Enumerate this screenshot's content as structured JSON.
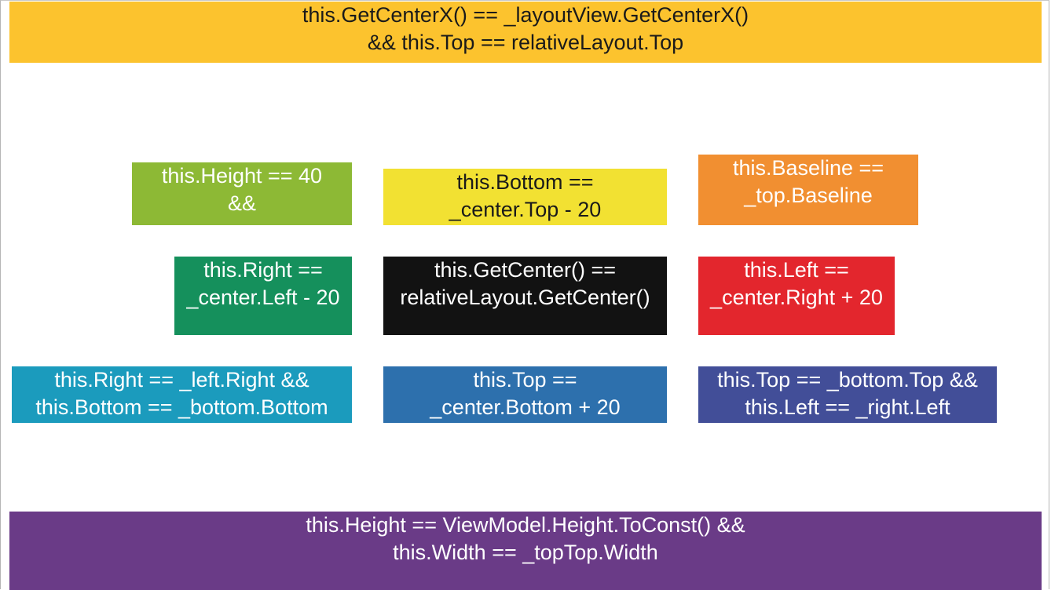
{
  "views": {
    "top": {
      "line1": "this.GetCenterX() == _layoutView.GetCenterX()",
      "line2": "&& this.Top == relativeLayout.Top",
      "color": "#fcc32e"
    },
    "top_left": {
      "line1": "this.Height == 40",
      "line2": "&&",
      "color": "#8db935"
    },
    "top_center": {
      "line1": "this.Bottom ==",
      "line2": "_center.Top - 20",
      "color": "#f2e132"
    },
    "top_right": {
      "line1": "this.Baseline ==",
      "line2": "_top.Baseline",
      "color": "#f18f31"
    },
    "mid_left": {
      "line1": "this.Right ==",
      "line2": "_center.Left - 20",
      "color": "#15905c"
    },
    "center": {
      "line1": "this.GetCenter() ==",
      "line2": "relativeLayout.GetCenter()",
      "color": "#121212"
    },
    "mid_right": {
      "line1": "this.Left ==",
      "line2": "_center.Right + 20",
      "color": "#e3262d"
    },
    "bottom_left": {
      "line1": "this.Right == _left.Right &&",
      "line2": "this.Bottom == _bottom.Bottom",
      "color": "#1b9bbd"
    },
    "bottom_center": {
      "line1": "this.Top ==",
      "line2": "_center.Bottom + 20",
      "color": "#2d70ad"
    },
    "bottom_right": {
      "line1": "this.Top == _bottom.Top &&",
      "line2": "this.Left == _right.Left",
      "color": "#424e98"
    },
    "bottom": {
      "line1": "this.Height == ViewModel.Height.ToConst() &&",
      "line2": "this.Width == _topTop.Width",
      "color": "#6a3b87"
    }
  }
}
